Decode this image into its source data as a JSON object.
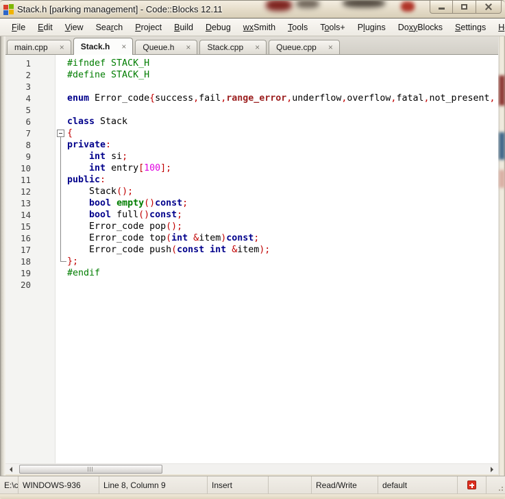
{
  "window": {
    "title": "Stack.h [parking management] - Code::Blocks 12.11",
    "controls": {
      "minimize": "minimize",
      "maximize": "maximize",
      "close": "close"
    }
  },
  "menu": {
    "items": [
      {
        "label": "File",
        "u": 0
      },
      {
        "label": "Edit",
        "u": 0
      },
      {
        "label": "View",
        "u": 0
      },
      {
        "label": "Search",
        "u": 3
      },
      {
        "label": "Project",
        "u": 0
      },
      {
        "label": "Build",
        "u": 0
      },
      {
        "label": "Debug",
        "u": 0
      },
      {
        "label": "wxSmith",
        "u": 0,
        "ulen": 2
      },
      {
        "label": "Tools",
        "u": 0
      },
      {
        "label": "Tools+",
        "u": 1
      },
      {
        "label": "Plugins",
        "u": 1
      },
      {
        "label": "DoxyBlocks",
        "u": 2,
        "ulen": 2
      },
      {
        "label": "Settings",
        "u": 0
      },
      {
        "label": "Help",
        "u": 0
      }
    ]
  },
  "tabs": {
    "close_glyph": "×",
    "items": [
      {
        "label": "main.cpp",
        "active": false
      },
      {
        "label": "Stack.h",
        "active": true
      },
      {
        "label": "Queue.h",
        "active": false
      },
      {
        "label": "Stack.cpp",
        "active": false
      },
      {
        "label": "Queue.cpp",
        "active": false
      }
    ]
  },
  "editor": {
    "language": "C++",
    "lines": [
      {
        "n": 1,
        "fold": "none",
        "tokens": [
          [
            "pp",
            "#ifndef STACK_H"
          ]
        ]
      },
      {
        "n": 2,
        "fold": "none",
        "tokens": [
          [
            "pp",
            "#define STACK_H"
          ]
        ]
      },
      {
        "n": 3,
        "fold": "none",
        "tokens": []
      },
      {
        "n": 4,
        "fold": "none",
        "tokens": [
          [
            "kw",
            "enum"
          ],
          [
            "pl",
            " Error_code"
          ],
          [
            "op",
            "{"
          ],
          [
            "pl",
            "success"
          ],
          [
            "op",
            ","
          ],
          [
            "pl",
            "fail"
          ],
          [
            "op",
            ","
          ],
          [
            "kw2",
            "range_error"
          ],
          [
            "op",
            ","
          ],
          [
            "pl",
            "underflow"
          ],
          [
            "op",
            ","
          ],
          [
            "pl",
            "overflow"
          ],
          [
            "op",
            ","
          ],
          [
            "pl",
            "fatal"
          ],
          [
            "op",
            ","
          ],
          [
            "pl",
            "not_present"
          ],
          [
            "op",
            ","
          ]
        ]
      },
      {
        "n": 5,
        "fold": "none",
        "tokens": []
      },
      {
        "n": 6,
        "fold": "none",
        "tokens": [
          [
            "kw",
            "class"
          ],
          [
            "pl",
            " Stack"
          ]
        ]
      },
      {
        "n": 7,
        "fold": "start",
        "tokens": [
          [
            "op",
            "{"
          ]
        ]
      },
      {
        "n": 8,
        "fold": "mid",
        "tokens": [
          [
            "kw",
            "private"
          ],
          [
            "op",
            ":"
          ]
        ]
      },
      {
        "n": 9,
        "fold": "mid",
        "tokens": [
          [
            "pl",
            "    "
          ],
          [
            "kw",
            "int"
          ],
          [
            "pl",
            " si"
          ],
          [
            "op",
            ";"
          ]
        ]
      },
      {
        "n": 10,
        "fold": "mid",
        "tokens": [
          [
            "pl",
            "    "
          ],
          [
            "kw",
            "int"
          ],
          [
            "pl",
            " entry"
          ],
          [
            "op",
            "["
          ],
          [
            "num",
            "100"
          ],
          [
            "op",
            "];"
          ]
        ]
      },
      {
        "n": 11,
        "fold": "mid",
        "tokens": [
          [
            "kw",
            "public"
          ],
          [
            "op",
            ":"
          ]
        ]
      },
      {
        "n": 12,
        "fold": "mid",
        "tokens": [
          [
            "pl",
            "    Stack"
          ],
          [
            "op",
            "();"
          ]
        ]
      },
      {
        "n": 13,
        "fold": "mid",
        "tokens": [
          [
            "pl",
            "    "
          ],
          [
            "kw",
            "bool"
          ],
          [
            "pl",
            " "
          ],
          [
            "kw3",
            "empty"
          ],
          [
            "op",
            "()"
          ],
          [
            "kw",
            "const"
          ],
          [
            "op",
            ";"
          ]
        ]
      },
      {
        "n": 14,
        "fold": "mid",
        "tokens": [
          [
            "pl",
            "    "
          ],
          [
            "kw",
            "bool"
          ],
          [
            "pl",
            " full"
          ],
          [
            "op",
            "()"
          ],
          [
            "kw",
            "const"
          ],
          [
            "op",
            ";"
          ]
        ]
      },
      {
        "n": 15,
        "fold": "mid",
        "tokens": [
          [
            "pl",
            "    Error_code pop"
          ],
          [
            "op",
            "();"
          ]
        ]
      },
      {
        "n": 16,
        "fold": "mid",
        "tokens": [
          [
            "pl",
            "    Error_code top"
          ],
          [
            "op",
            "("
          ],
          [
            "kw",
            "int"
          ],
          [
            "pl",
            " "
          ],
          [
            "op",
            "&"
          ],
          [
            "pl",
            "item"
          ],
          [
            "op",
            ")"
          ],
          [
            "kw",
            "const"
          ],
          [
            "op",
            ";"
          ]
        ]
      },
      {
        "n": 17,
        "fold": "mid",
        "tokens": [
          [
            "pl",
            "    Error_code push"
          ],
          [
            "op",
            "("
          ],
          [
            "kw",
            "const"
          ],
          [
            "pl",
            " "
          ],
          [
            "kw",
            "int"
          ],
          [
            "pl",
            " "
          ],
          [
            "op",
            "&"
          ],
          [
            "pl",
            "item"
          ],
          [
            "op",
            ");"
          ]
        ]
      },
      {
        "n": 18,
        "fold": "end",
        "tokens": [
          [
            "op",
            "};"
          ]
        ]
      },
      {
        "n": 19,
        "fold": "none",
        "tokens": [
          [
            "pp",
            "#endif"
          ]
        ]
      },
      {
        "n": 20,
        "fold": "none",
        "tokens": []
      }
    ]
  },
  "status": {
    "items": [
      "E:\\co",
      "WINDOWS-936",
      "Line 8, Column 9",
      "Insert",
      "",
      "Read/Write",
      "default"
    ],
    "icon": "red-cross-badge"
  },
  "colors": {
    "preprocessor": "#007D00",
    "keyword": "#00008B",
    "keyword2": "#9B1E1E",
    "keyword3": "#007D00",
    "operator": "#C00000",
    "number": "#E000E0",
    "plain": "#000000",
    "line_number": "#404040",
    "titlebar_base": "#E7DFCE",
    "status_flag": "#DC2F1F"
  }
}
